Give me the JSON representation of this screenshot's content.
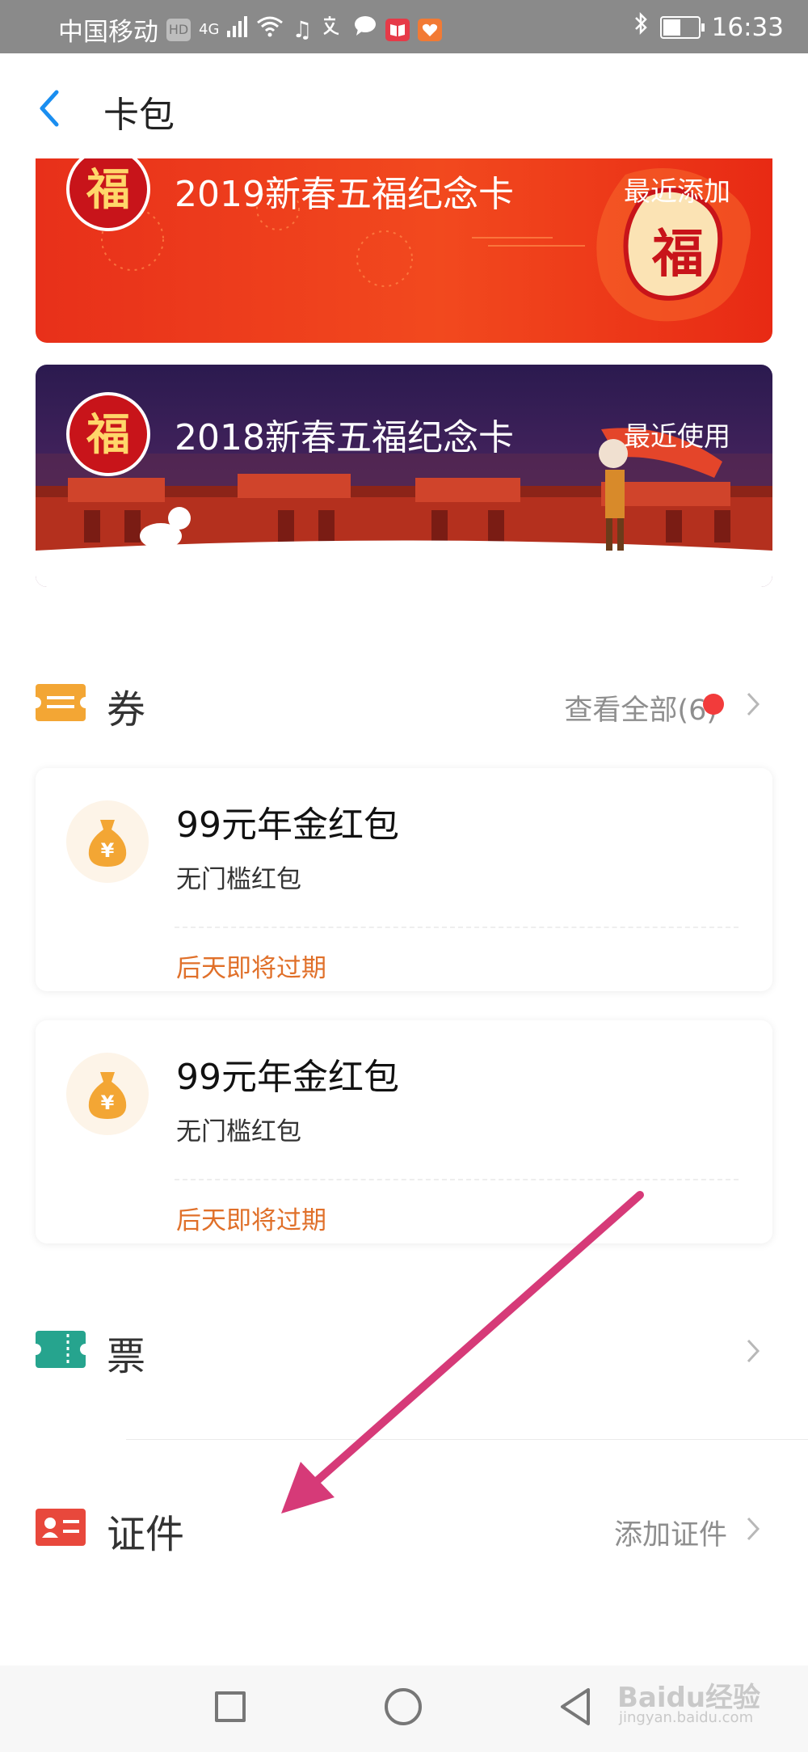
{
  "status_bar": {
    "carrier": "中国移动",
    "hd": "HD",
    "network": "4G",
    "time": "16:33",
    "battery_level": 0.55
  },
  "header": {
    "title": "卡包"
  },
  "cards": [
    {
      "title": "2019新春五福纪念卡",
      "tag": "最近添加",
      "badge": "福"
    },
    {
      "title": "2018新春五福纪念卡",
      "tag": "最近使用",
      "badge": "福"
    }
  ],
  "coupons_section": {
    "title": "券",
    "view_all": "查看全部(6)"
  },
  "coupons": [
    {
      "title": "99元年金红包",
      "subtitle": "无门槛红包",
      "expire": "后天即将过期",
      "symbol": "¥"
    },
    {
      "title": "99元年金红包",
      "subtitle": "无门槛红包",
      "expire": "后天即将过期",
      "symbol": "¥"
    }
  ],
  "tickets_section": {
    "title": "票"
  },
  "ids_section": {
    "title": "证件",
    "action": "添加证件"
  },
  "watermark": {
    "brand": "Baidu经验",
    "url": "jingyan.baidu.com"
  },
  "colors": {
    "accent_blue": "#1a8ef0",
    "coupon_icon": "#f3a634",
    "ticket_icon": "#26a48e",
    "id_icon": "#e8483c",
    "expire_text": "#e0702a",
    "arrow": "#d63a78"
  }
}
